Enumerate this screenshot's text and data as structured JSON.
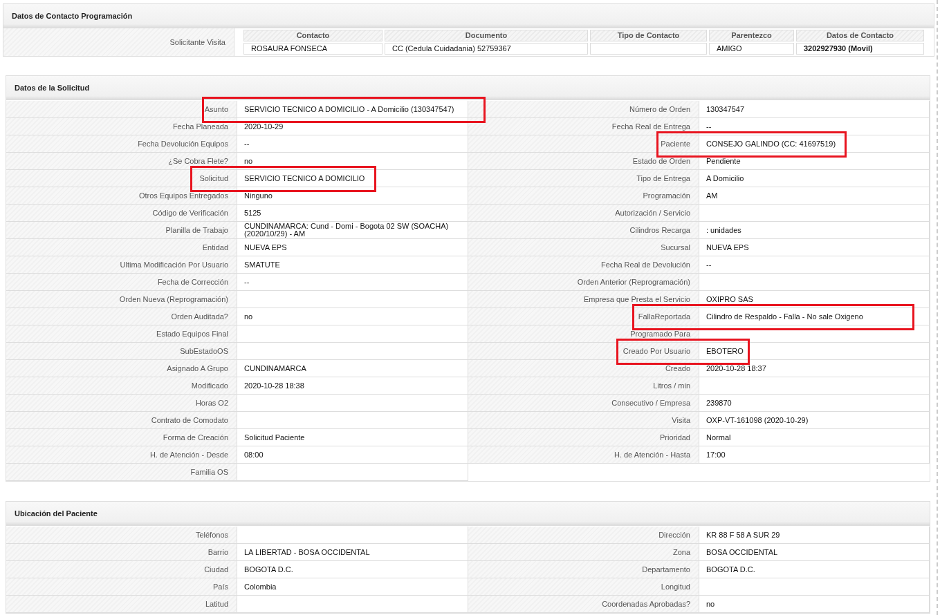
{
  "contact_section": {
    "title": "Datos de Contacto Programación",
    "row_label": "Solicitante Visita",
    "cells": [
      {
        "header": "Contacto",
        "value": "ROSAURA FONSECA"
      },
      {
        "header": "Documento",
        "value": "CC (Cedula Cuidadania) 52759367"
      },
      {
        "header": "Tipo de Contacto"
      },
      {
        "header": "Parentezco",
        "value": "AMIGO"
      },
      {
        "header": "Datos de Contacto",
        "value": "3202927930 (Movil)"
      }
    ]
  },
  "request_section": {
    "title": "Datos de la Solicitud",
    "left": [
      {
        "label": "Asunto",
        "value": "SERVICIO TECNICO A DOMICILIO - A Domicilio (130347547)",
        "highlighted": true
      },
      {
        "label": "Fecha Planeada",
        "value": "2020-10-29",
        "highlighted": false
      },
      {
        "label": "Fecha Devolución Equipos",
        "value": "--",
        "highlighted": false
      },
      {
        "label": "¿Se Cobra Flete?",
        "value": "no",
        "highlighted": false
      },
      {
        "label": "Solicitud",
        "value": "SERVICIO TECNICO A DOMICILIO",
        "highlighted": true
      },
      {
        "label": "Otros Equipos Entregados",
        "value": "Ninguno",
        "highlighted": false
      },
      {
        "label": "Código de Verificación",
        "value": "5125",
        "highlighted": false
      },
      {
        "label": "Planilla de Trabajo",
        "value": "CUNDINAMARCA: Cund - Domi - Bogota 02 SW (SOACHA) (2020/10/29) - AM",
        "highlighted": false
      },
      {
        "label": "Entidad",
        "value": "NUEVA EPS",
        "highlighted": false
      },
      {
        "label": "Ultima Modificación Por Usuario",
        "value": "SMATUTE",
        "highlighted": false
      },
      {
        "label": "Fecha de Corrección",
        "value": "--",
        "highlighted": false
      },
      {
        "label": "Orden Nueva (Reprogramación)",
        "highlighted": false
      },
      {
        "label": "Orden Auditada?",
        "value": "no",
        "highlighted": false
      },
      {
        "label": "Estado Equipos Final",
        "highlighted": false
      },
      {
        "label": "SubEstadoOS",
        "highlighted": false
      },
      {
        "label": "Asignado A Grupo",
        "value": "CUNDINAMARCA",
        "highlighted": false
      },
      {
        "label": "Modificado",
        "value": "2020-10-28 18:38",
        "highlighted": false
      },
      {
        "label": "Horas O2",
        "highlighted": false
      },
      {
        "label": "Contrato de Comodato",
        "highlighted": false
      },
      {
        "label": "Forma de Creación",
        "value": "Solicitud Paciente",
        "highlighted": false
      },
      {
        "label": "H. de Atención - Desde",
        "value": "08:00",
        "highlighted": false
      },
      {
        "label": "Familia OS",
        "highlighted": false
      }
    ],
    "right": [
      {
        "label": "Número de Orden",
        "value": "130347547",
        "highlighted": false
      },
      {
        "label": "Fecha Real de Entrega",
        "value": "--",
        "highlighted": false
      },
      {
        "label": "Paciente",
        "value": "CONSEJO GALINDO (CC: 41697519)",
        "highlighted": true
      },
      {
        "label": "Estado de Orden",
        "value": "Pendiente",
        "highlighted": false
      },
      {
        "label": "Tipo de Entrega",
        "value": "A Domicilio",
        "highlighted": false
      },
      {
        "label": "Programación",
        "value": "AM",
        "highlighted": false
      },
      {
        "label": "Autorización / Servicio",
        "highlighted": false
      },
      {
        "label": "Cilindros Recarga",
        "value": ": unidades",
        "highlighted": false
      },
      {
        "label": "Sucursal",
        "value": "NUEVA EPS",
        "highlighted": false
      },
      {
        "label": "Fecha Real de Devolución",
        "value": "--",
        "highlighted": false
      },
      {
        "label": "Orden Anterior (Reprogramación)",
        "highlighted": false
      },
      {
        "label": "Empresa que Presta el Servicio",
        "value": "OXIPRO SAS",
        "highlighted": false
      },
      {
        "label": "FallaReportada",
        "value": "Cilindro de Respaldo - Falla - No sale Oxigeno",
        "highlighted": true
      },
      {
        "label": "Programado Para",
        "highlighted": false
      },
      {
        "label": "Creado Por Usuario",
        "value": "EBOTERO",
        "highlighted": true
      },
      {
        "label": "Creado",
        "value": "2020-10-28 18:37",
        "highlighted": false
      },
      {
        "label": "Litros / min",
        "highlighted": false
      },
      {
        "label": "Consecutivo / Empresa",
        "value": "239870",
        "highlighted": false
      },
      {
        "label": "Visita",
        "value": "OXP-VT-161098 (2020-10-29)",
        "highlighted": false
      },
      {
        "label": "Prioridad",
        "value": "Normal",
        "highlighted": false
      },
      {
        "label": "H. de Atención - Hasta",
        "value": "17:00",
        "highlighted": false
      }
    ]
  },
  "location_section": {
    "title": "Ubicación del Paciente",
    "left": [
      {
        "label": "Teléfonos",
        "highlighted": false
      },
      {
        "label": "Barrio",
        "value": "LA LIBERTAD - BOSA OCCIDENTAL",
        "highlighted": false
      },
      {
        "label": "Ciudad",
        "value": "BOGOTA D.C.",
        "highlighted": false
      },
      {
        "label": "País",
        "value": "Colombia",
        "highlighted": false
      },
      {
        "label": "Latitud",
        "highlighted": false
      }
    ],
    "right": [
      {
        "label": "Dirección",
        "value": "KR 88 F 58 A SUR 29",
        "highlighted": false
      },
      {
        "label": "Zona",
        "value": "BOSA OCCIDENTAL",
        "highlighted": false
      },
      {
        "label": "Departamento",
        "value": "BOGOTA D.C.",
        "highlighted": false
      },
      {
        "label": "Longitud",
        "highlighted": false
      },
      {
        "label": "Coordenadas Aprobadas?",
        "value": "no",
        "highlighted": false
      }
    ]
  }
}
